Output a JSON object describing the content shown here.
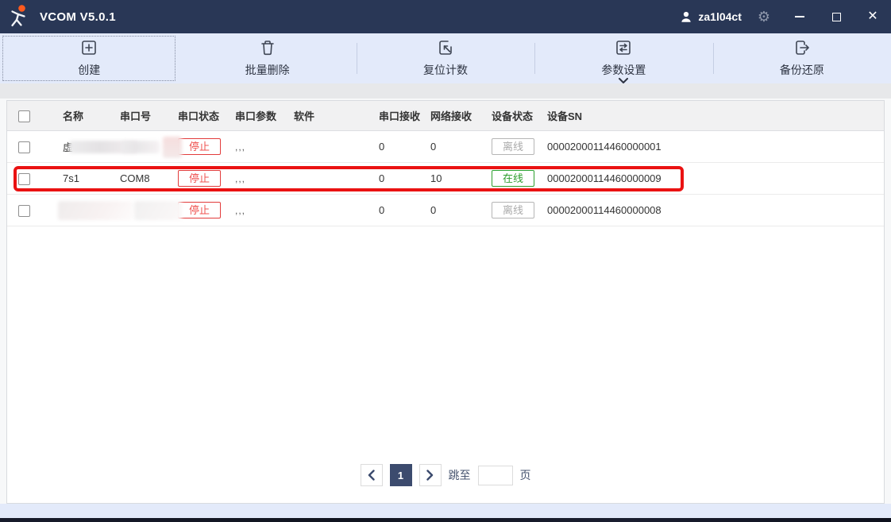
{
  "colors": {
    "titlebar-bg": "#293756",
    "toolbar-bg": "#e3eafa",
    "badge-red": "#ef5350",
    "badge-green": "#2f9e2f",
    "badge-gray": "#ababab",
    "annotation-red": "#ea1212",
    "page-active-bg": "#3c4b6e",
    "logo-orange": "#ff5a1e"
  },
  "icons": {
    "close": "✕",
    "gear": "⚙"
  },
  "titlebar": {
    "title": "VCOM V5.0.1",
    "username": "za1l04ct"
  },
  "toolbar": {
    "create": "创建",
    "batch_delete": "批量删除",
    "reset_count": "复位计数",
    "param_settings": "参数设置",
    "backup_restore": "备份还原"
  },
  "table": {
    "headers": {
      "name": "名称",
      "com": "串口号",
      "port_status": "串口状态",
      "port_params": "串口参数",
      "software": "软件",
      "serial_rx": "串口接收",
      "net_rx": "网络接收",
      "device_status": "设备状态",
      "sn": "设备SN"
    },
    "rows": [
      {
        "name": "虚",
        "com": "",
        "port_status": "停止",
        "port_params": ",,,",
        "software": "",
        "serial_rx": "0",
        "net_rx": "0",
        "device_status": "离线",
        "sn": "00002000114460000001"
      },
      {
        "name": "7s1",
        "com": "COM8",
        "port_status": "停止",
        "port_params": ",,,",
        "software": "",
        "serial_rx": "0",
        "net_rx": "10",
        "device_status": "在线",
        "sn": "00002000114460000009"
      },
      {
        "name": "",
        "com": "",
        "port_status": "停止",
        "port_params": ",,,",
        "software": "",
        "serial_rx": "0",
        "net_rx": "0",
        "device_status": "离线",
        "sn": "00002000114460000008"
      }
    ]
  },
  "pagination": {
    "current_page": "1",
    "jump_label": "跳至",
    "page_unit": "页",
    "jump_value": ""
  }
}
